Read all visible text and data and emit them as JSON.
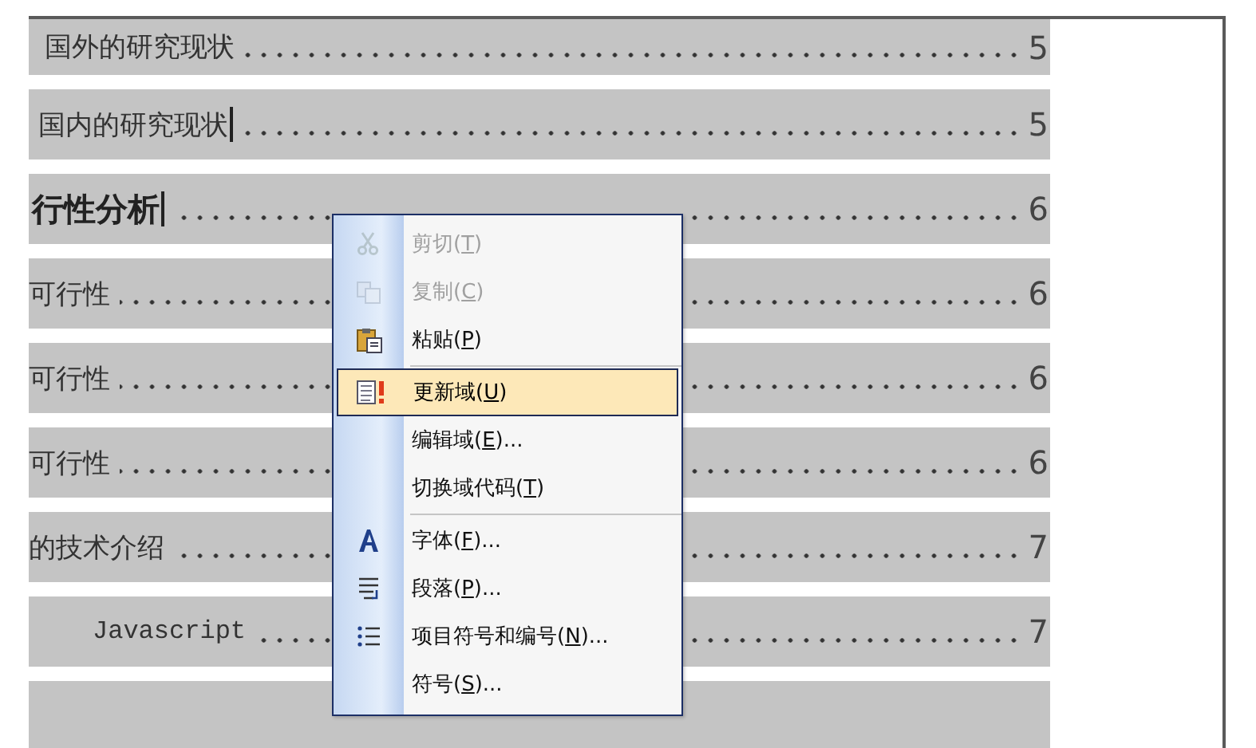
{
  "toc": {
    "rows": [
      {
        "title": "国外的研究现状",
        "page": "5",
        "kind": "entry",
        "caret": false
      },
      {
        "title": "国内的研究现状",
        "page": "5",
        "kind": "entry",
        "caret": true
      },
      {
        "title": "行性分析",
        "page": "6",
        "kind": "heading",
        "caret": true
      },
      {
        "title": "可行性",
        "page": "6",
        "kind": "entry",
        "caret": false
      },
      {
        "title": "可行性",
        "page": "6",
        "kind": "entry",
        "caret": false
      },
      {
        "title": "可行性",
        "page": "6",
        "kind": "entry",
        "caret": false
      },
      {
        "title": "的技术介绍",
        "page": "7",
        "kind": "entry",
        "caret": false,
        "children": [
          {
            "title": "Javascript",
            "page": "7",
            "kind": "code",
            "caret": false
          },
          {
            "kind": "cut"
          }
        ]
      }
    ]
  },
  "context_menu": {
    "items": [
      {
        "kind": "item",
        "before": "剪切(",
        "key": "T",
        "after": ")",
        "disabled": true,
        "selected": false
      },
      {
        "kind": "item",
        "before": "复制(",
        "key": "C",
        "after": ")",
        "disabled": true,
        "selected": false
      },
      {
        "kind": "item",
        "before": "粘贴(",
        "key": "P",
        "after": ")",
        "disabled": false,
        "selected": false
      },
      {
        "kind": "separator"
      },
      {
        "kind": "item",
        "before": "更新域(",
        "key": "U",
        "after": ")",
        "disabled": false,
        "selected": true
      },
      {
        "kind": "item",
        "before": "编辑域(",
        "key": "E",
        "after": ")...",
        "disabled": false,
        "selected": false
      },
      {
        "kind": "item",
        "before": "切换域代码(",
        "key": "T",
        "after": ")",
        "disabled": false,
        "selected": false
      },
      {
        "kind": "separator"
      },
      {
        "kind": "item",
        "before": "字体(",
        "key": "F",
        "after": ")...",
        "disabled": false,
        "selected": false
      },
      {
        "kind": "item",
        "before": "段落(",
        "key": "P",
        "after": ")...",
        "disabled": false,
        "selected": false
      },
      {
        "kind": "item",
        "before": "项目符号和编号(",
        "key": "N",
        "after": ")...",
        "disabled": false,
        "selected": false
      },
      {
        "kind": "item",
        "before": "符号(",
        "key": "S",
        "after": ")...",
        "disabled": false,
        "selected": false
      }
    ]
  }
}
